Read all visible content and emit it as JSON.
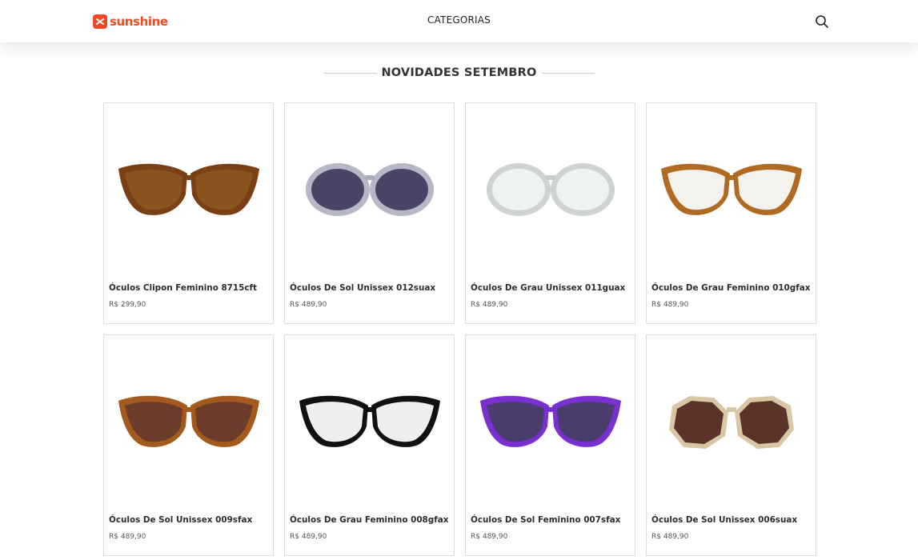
{
  "header": {
    "logo_text": "sunshine",
    "nav_label": "CATEGORIAS",
    "brand_color": "#ef4a23",
    "search_icon": "search-icon"
  },
  "section": {
    "title": "NOVIDADES SETEMBRO"
  },
  "products": [
    {
      "name": "Óculos Clipon Feminino 8715cft",
      "price": "R$ 299,90",
      "frame": "#7a3f14",
      "lens": "#8a5420",
      "style": "cat"
    },
    {
      "name": "Óculos De Sol Unissex 012suax",
      "price": "R$ 489,90",
      "frame": "#a9adbb",
      "lens": "#4a4566",
      "style": "round"
    },
    {
      "name": "Óculos De Grau Unissex 011guax",
      "price": "R$ 489,90",
      "frame": "#c8cbcc",
      "lens": "#eef2f2",
      "style": "round"
    },
    {
      "name": "Óculos De Grau Feminino 010gfax",
      "price": "R$ 489,90",
      "frame": "#b06a22",
      "lens": "#f4f2ec",
      "style": "cat"
    },
    {
      "name": "Óculos De Sol Unissex 009sfax",
      "price": "R$ 489,90",
      "frame": "#a35a1c",
      "lens": "#6d3d2b",
      "style": "cat"
    },
    {
      "name": "Óculos De Grau Feminino 008gfax",
      "price": "R$ 489,90",
      "frame": "#111111",
      "lens": "#eef0ee",
      "style": "cat"
    },
    {
      "name": "Óculos De Sol Feminino 007sfax",
      "price": "R$ 489,90",
      "frame": "#7a2fd0",
      "lens": "#4b3c6e",
      "style": "cat"
    },
    {
      "name": "Óculos De Sol Unissex 006suax",
      "price": "R$ 489,90",
      "frame": "#d8c6a4",
      "lens": "#5a3428",
      "style": "hex"
    }
  ]
}
